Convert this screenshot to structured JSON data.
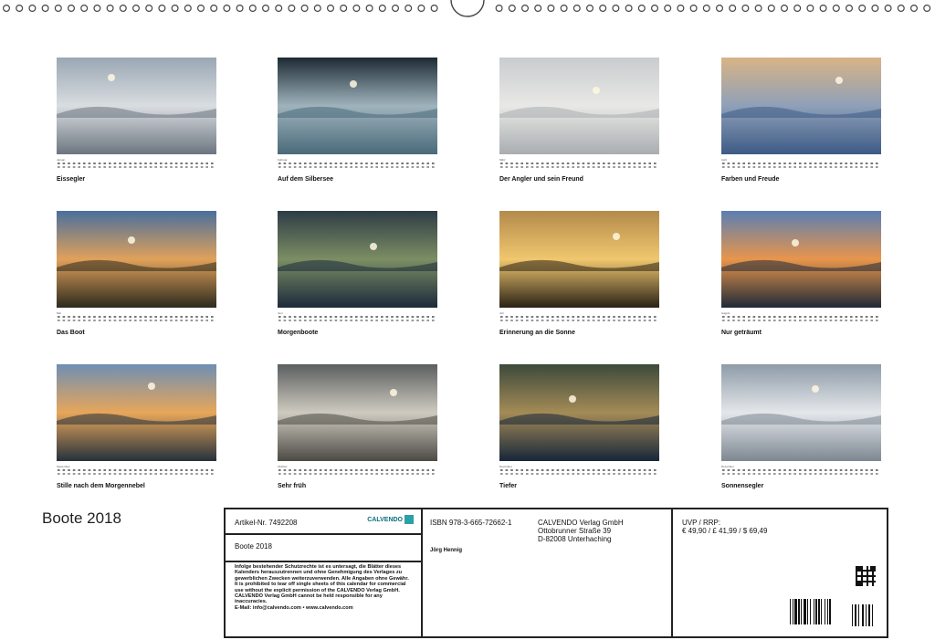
{
  "cover": {
    "title": "Boote 2018"
  },
  "months": [
    {
      "name": "Januar",
      "title": "Eissegler"
    },
    {
      "name": "Februar",
      "title": "Auf dem Silbersee"
    },
    {
      "name": "März",
      "title": "Der Angler und sein Freund"
    },
    {
      "name": "April",
      "title": "Farben und Freude"
    },
    {
      "name": "Mai",
      "title": "Das Boot"
    },
    {
      "name": "Juni",
      "title": "Morgenboote"
    },
    {
      "name": "Juli",
      "title": "Erinnerung an die Sonne"
    },
    {
      "name": "August",
      "title": "Nur geträumt"
    },
    {
      "name": "September",
      "title": "Stille nach dem Morgennebel"
    },
    {
      "name": "Oktober",
      "title": "Sehr früh"
    },
    {
      "name": "November",
      "title": "Tiefer"
    },
    {
      "name": "Dezember",
      "title": "Sonnensegler"
    }
  ],
  "info": {
    "article": "Artikel-Nr. 7492208",
    "logo": "CALVENDO",
    "title": "Boote 2018",
    "notice_de": "Infolge bestehender Schutzrechte ist es untersagt, die Blätter dieses Kalenders herauszutrennen und ohne Genehmigung des Verlages zu gewerblichen Zwecken weiterzuverwenden. Alle Angaben ohne Gewähr.",
    "notice_en": "It is prohibited to tear off single sheets of this calendar for commercial use without the explicit permission of the CALVENDO Verlag GmbH. CALVENDO Verlag GmbH cannot be held responsible for any inaccuracies.",
    "email": "E-Mail: info@calvendo.com • www.calvendo.com",
    "isbn": "ISBN 978-3-665-72662-1",
    "author": "Jörg Hennig",
    "publisher": "CALVENDO Verlag GmbH",
    "street": "Ottobrunner Straße 39",
    "city": "D-82008 Unterhaching",
    "price_label": "UVP / RRP:",
    "price": "€ 49,90 / £ 41,99 / $ 69,49",
    "barcode_text": "9 783665 726621"
  }
}
